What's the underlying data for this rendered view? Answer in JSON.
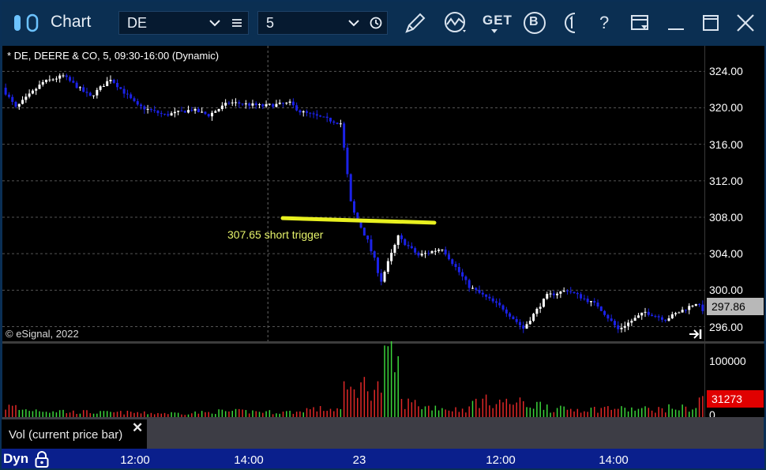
{
  "app": {
    "title": "Chart"
  },
  "toolbar": {
    "symbol_value": "DE",
    "interval_value": "5",
    "get_label": "GET",
    "b_label": "B",
    "help_label": "?"
  },
  "chart_header": "* DE, DEERE & CO, 5, 09:30-16:00 (Dynamic)",
  "watermark": "© eSignal, 2022",
  "annotation": {
    "text": "307.65 short trigger",
    "price": 307.65,
    "color": "#e8f020"
  },
  "price_axis": {
    "ticks": [
      "324.00",
      "320.00",
      "316.00",
      "312.00",
      "308.00",
      "304.00",
      "300.00",
      "296.00"
    ],
    "last_price": "297.86"
  },
  "volume_axis": {
    "ticks": [
      "100000",
      "0"
    ],
    "last_volume": "31273"
  },
  "volume_panel_label": "Vol (current price bar)",
  "time_axis": {
    "mode_label": "Dyn",
    "ticks": [
      "12:00",
      "14:00",
      "23",
      "12:00",
      "14:00"
    ]
  },
  "colors": {
    "up_candle": "#ffffff",
    "down_candle": "#1b22e8",
    "volume_up": "#3bd53b",
    "volume_down": "#e02828",
    "last_price_box": "#b8b8b8",
    "last_volume_box": "#e00000",
    "grid": "#555555"
  },
  "chart_data": {
    "type": "candlestick",
    "symbol": "DE",
    "interval": "5",
    "ylim": [
      294.4,
      326.8
    ],
    "volume_ylim": [
      0,
      131000
    ],
    "grid": true,
    "session_break_index": 78,
    "series": [
      {
        "name": "price",
        "segments": [
          {
            "from": 322.2,
            "to": 320.0,
            "bars": 4,
            "vol": 18000
          },
          {
            "from": 320.0,
            "to": 322.8,
            "bars": 8,
            "vol": 13000
          },
          {
            "from": 322.8,
            "to": 323.5,
            "bars": 6,
            "vol": 11000
          },
          {
            "from": 323.5,
            "to": 321.2,
            "bars": 8,
            "vol": 9000
          },
          {
            "from": 321.2,
            "to": 323.2,
            "bars": 6,
            "vol": 8000
          },
          {
            "from": 323.2,
            "to": 320.2,
            "bars": 8,
            "vol": 8000
          },
          {
            "from": 320.2,
            "to": 319.2,
            "bars": 8,
            "vol": 7000
          },
          {
            "from": 319.2,
            "to": 319.8,
            "bars": 8,
            "vol": 7000
          },
          {
            "from": 319.8,
            "to": 319.2,
            "bars": 5,
            "vol": 8000
          },
          {
            "from": 319.2,
            "to": 320.6,
            "bars": 6,
            "vol": 10000
          },
          {
            "from": 320.6,
            "to": 320.2,
            "bars": 10,
            "vol": 10000
          },
          {
            "from": 320.2,
            "to": 320.5,
            "bars": 8,
            "vol": 9000
          },
          {
            "from": 320.5,
            "to": 319.6,
            "bars": 3,
            "vol": 9000
          },
          {
            "from": 319.6,
            "to": 318.3,
            "bars": 12,
            "vol": 14000
          },
          {
            "from": 318.3,
            "to": 309.2,
            "bars": 3,
            "vol": 45000
          },
          {
            "from": 309.2,
            "to": 305.4,
            "bars": 5,
            "vol": 55000
          },
          {
            "from": 305.4,
            "to": 301.1,
            "bars": 4,
            "vol": 52000
          },
          {
            "from": 301.1,
            "to": 305.8,
            "bars": 5,
            "vol": 95000
          },
          {
            "from": 305.8,
            "to": 303.8,
            "bars": 6,
            "vol": 25000
          },
          {
            "from": 303.8,
            "to": 304.6,
            "bars": 7,
            "vol": 18000
          },
          {
            "from": 304.6,
            "to": 300.4,
            "bars": 8,
            "vol": 14000
          },
          {
            "from": 300.4,
            "to": 298.0,
            "bars": 10,
            "vol": 28000
          },
          {
            "from": 298.0,
            "to": 295.8,
            "bars": 6,
            "vol": 25000
          },
          {
            "from": 295.8,
            "to": 299.4,
            "bars": 7,
            "vol": 22000
          },
          {
            "from": 299.4,
            "to": 300.0,
            "bars": 6,
            "vol": 14000
          },
          {
            "from": 300.0,
            "to": 298.3,
            "bars": 9,
            "vol": 14000
          },
          {
            "from": 298.3,
            "to": 295.7,
            "bars": 6,
            "vol": 16000
          },
          {
            "from": 295.7,
            "to": 297.6,
            "bars": 8,
            "vol": 14000
          },
          {
            "from": 297.6,
            "to": 296.8,
            "bars": 6,
            "vol": 14000
          },
          {
            "from": 296.8,
            "to": 298.6,
            "bars": 9,
            "vol": 16000
          },
          {
            "from": 298.6,
            "to": 297.86,
            "bars": 2,
            "vol": 31273
          }
        ]
      }
    ]
  }
}
